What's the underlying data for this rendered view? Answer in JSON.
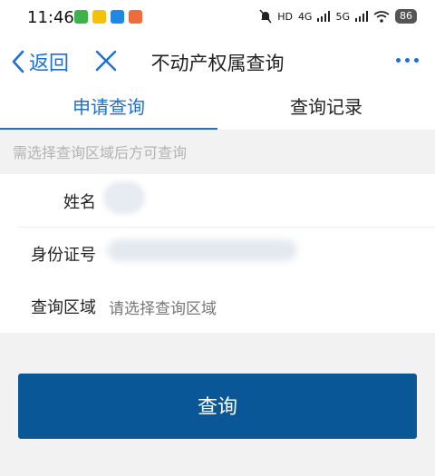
{
  "status": {
    "time": "11:46",
    "battery": "86",
    "network": [
      "HD",
      "4G",
      "5G"
    ]
  },
  "nav": {
    "back_label": "返回",
    "title": "不动产权属查询"
  },
  "tabs": [
    {
      "label": "申请查询"
    },
    {
      "label": "查询记录"
    }
  ],
  "hint": "需选择查询区域后方可查询",
  "form": {
    "name_label": "姓名",
    "id_label": "身份证号",
    "region_label": "查询区域",
    "region_placeholder": "请选择查询区域"
  },
  "submit_label": "查询",
  "colors": {
    "accent": "#1a6fd9",
    "button": "#0a5797"
  }
}
